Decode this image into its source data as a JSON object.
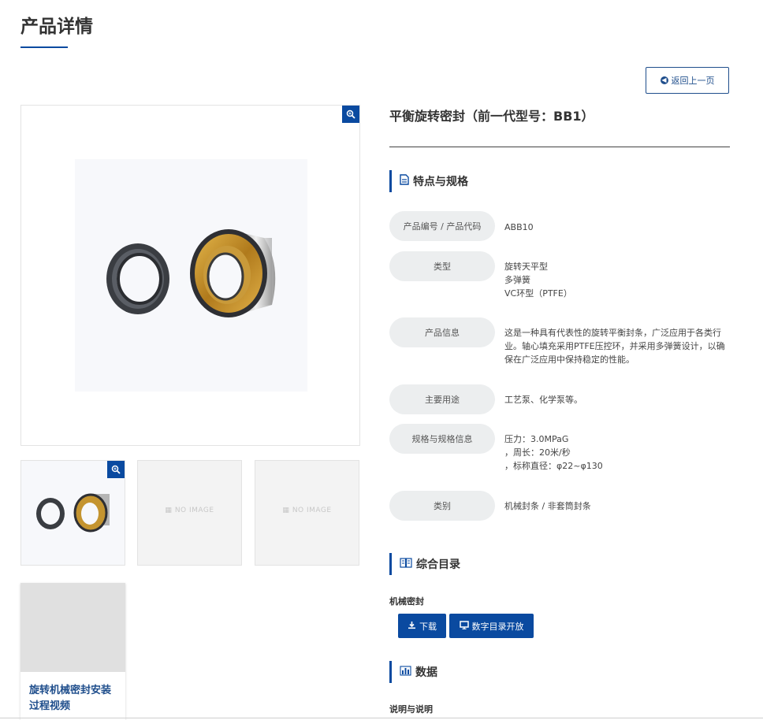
{
  "page": {
    "title": "产品详情"
  },
  "back_button": {
    "label": "返回上一页"
  },
  "gallery": {
    "no_image_text": "NO IMAGE",
    "video_title": "旋转机械密封安装过程视频"
  },
  "product": {
    "name": "平衡旋转密封（前一代型号：BB1）",
    "features_heading": "特点与规格",
    "specs": [
      {
        "label": "产品编号 / 产品代码",
        "value": "ABB10"
      },
      {
        "label": "类型",
        "value": "旋转天平型\n多弹簧\nVC环型（PTFE）"
      },
      {
        "label": "产品信息",
        "value": "这是一种具有代表性的旋转平衡封条，广泛应用于各类行业。轴心填充采用PTFE压控环，并采用多弹簧设计，以确保在广泛应用中保持稳定的性能。"
      },
      {
        "label": "主要用途",
        "value": "工艺泵、化学泵等。"
      },
      {
        "label": "规格与规格信息",
        "value": "压力：3.0MPaG\n，周长：20米/秒\n，标称直径：φ22~φ130"
      },
      {
        "label": "类别",
        "value": "机械封条 / 非套筒封条"
      }
    ],
    "catalog_heading": "综合目录",
    "catalog_label": "机械密封",
    "download_label": "下载",
    "digital_catalog_label": "数字目录开放",
    "data_heading": "数据",
    "description_label": "说明与说明"
  },
  "colors": {
    "accent": "#0a4aa0",
    "label_bg": "#eceeef"
  },
  "icons": [
    "zoom-icon",
    "arrow-left-circle-icon",
    "document-icon",
    "book-icon",
    "chart-icon",
    "download-icon",
    "monitor-icon",
    "image-placeholder-icon"
  ]
}
